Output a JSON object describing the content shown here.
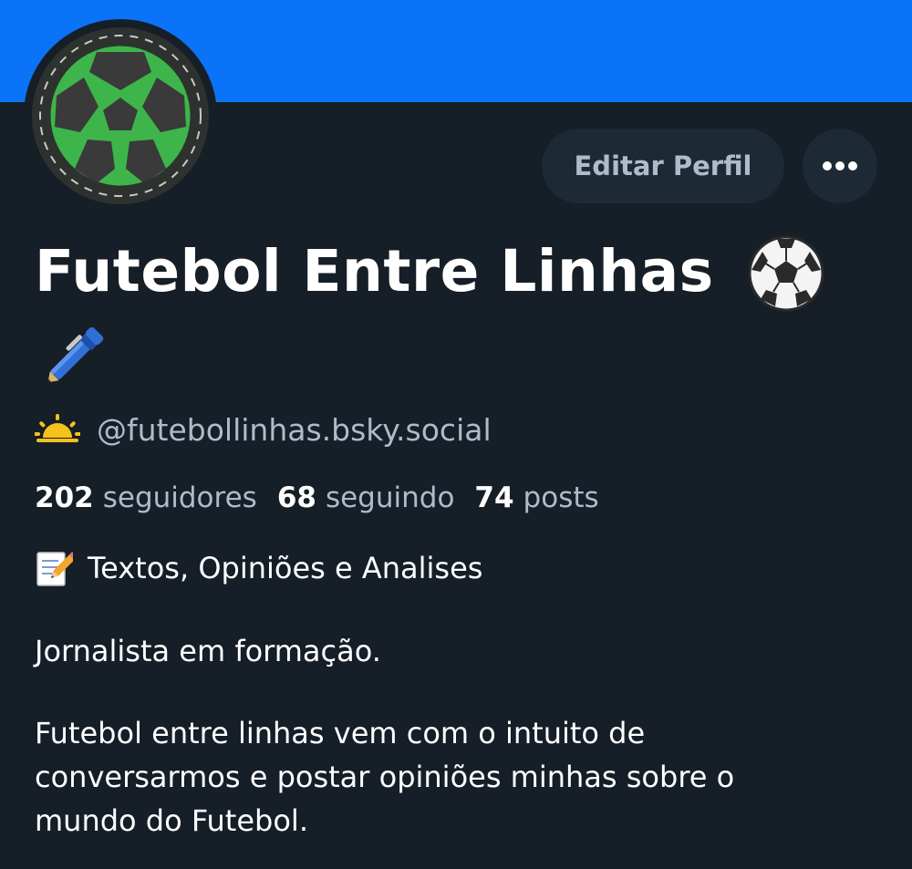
{
  "profile": {
    "display_name": "Futebol Entre Linhas",
    "name_emojis": [
      "soccer-ball-icon",
      "pen-icon"
    ],
    "handle": "@futebollinhas.bsky.social",
    "handle_icon": "sunrise-icon",
    "banner_color": "#0a73f7",
    "background_color": "#161e27"
  },
  "actions": {
    "edit_label": "Editar Perfil",
    "more_icon": "ellipsis-icon"
  },
  "stats": {
    "followers_count": "202",
    "followers_label": "seguidores",
    "following_count": "68",
    "following_label": "seguindo",
    "posts_count": "74",
    "posts_label": "posts"
  },
  "bio": {
    "line1": "Textos, Opiniões e Analises",
    "line1_icon": "memo-icon",
    "line2": "Jornalista em formação.",
    "line3": "Futebol entre linhas vem com o intuito de",
    "line4": "conversarmos e postar opiniões minhas sobre o",
    "line5": "mundo do Futebol."
  }
}
